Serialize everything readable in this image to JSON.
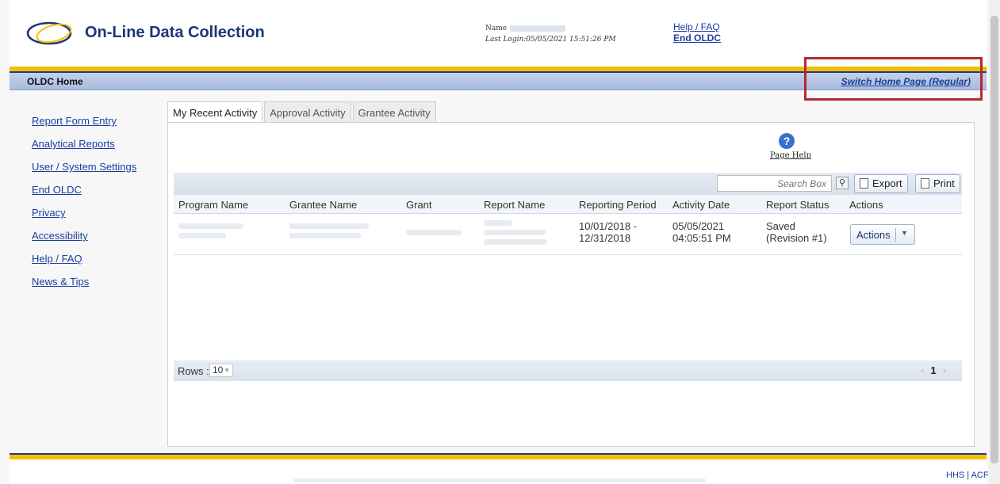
{
  "header": {
    "app_title": "On-Line Data Collection",
    "name_label": "Name",
    "last_login_label": "Last Login:",
    "last_login_value": "05/05/2021 15:51:26 PM",
    "help_link": "Help / FAQ",
    "end_link": "End OLDC"
  },
  "navbar": {
    "crumb": "OLDC Home",
    "switch_link": "Switch Home Page (Regular)"
  },
  "sidebar": {
    "items": [
      {
        "label": "Report Form Entry"
      },
      {
        "label": "Analytical Reports"
      },
      {
        "label": "User / System Settings"
      },
      {
        "label": "End OLDC"
      },
      {
        "label": "Privacy"
      },
      {
        "label": "Accessibility"
      },
      {
        "label": "Help / FAQ"
      },
      {
        "label": "News & Tips"
      }
    ]
  },
  "tabs": [
    {
      "label": "My Recent Activity",
      "active": true
    },
    {
      "label": "Approval Activity",
      "active": false
    },
    {
      "label": "Grantee Activity",
      "active": false
    }
  ],
  "page_help": "Page Help",
  "toolbar": {
    "search_placeholder": "Search Box",
    "export_label": "Export",
    "print_label": "Print"
  },
  "table": {
    "columns": [
      "Program Name",
      "Grantee Name",
      "Grant",
      "Report Name",
      "Reporting Period",
      "Activity Date",
      "Report Status",
      "Actions"
    ],
    "row": {
      "reporting_period_line1": "10/01/2018 -",
      "reporting_period_line2": "12/31/2018",
      "activity_date_line1": "05/05/2021",
      "activity_date_line2": "04:05:51 PM",
      "status_line1": "Saved",
      "status_line2": "(Revision #1)",
      "actions_label": "Actions"
    }
  },
  "grid_footer": {
    "rows_label": "Rows :",
    "rows_value": "10",
    "current_page": "1"
  },
  "footer": {
    "links": "HHS | ACF"
  },
  "colors": {
    "accent_yellow": "#f2c000",
    "accent_blue": "#20378a",
    "link": "#1a3e9e",
    "highlight": "#b7282e"
  }
}
